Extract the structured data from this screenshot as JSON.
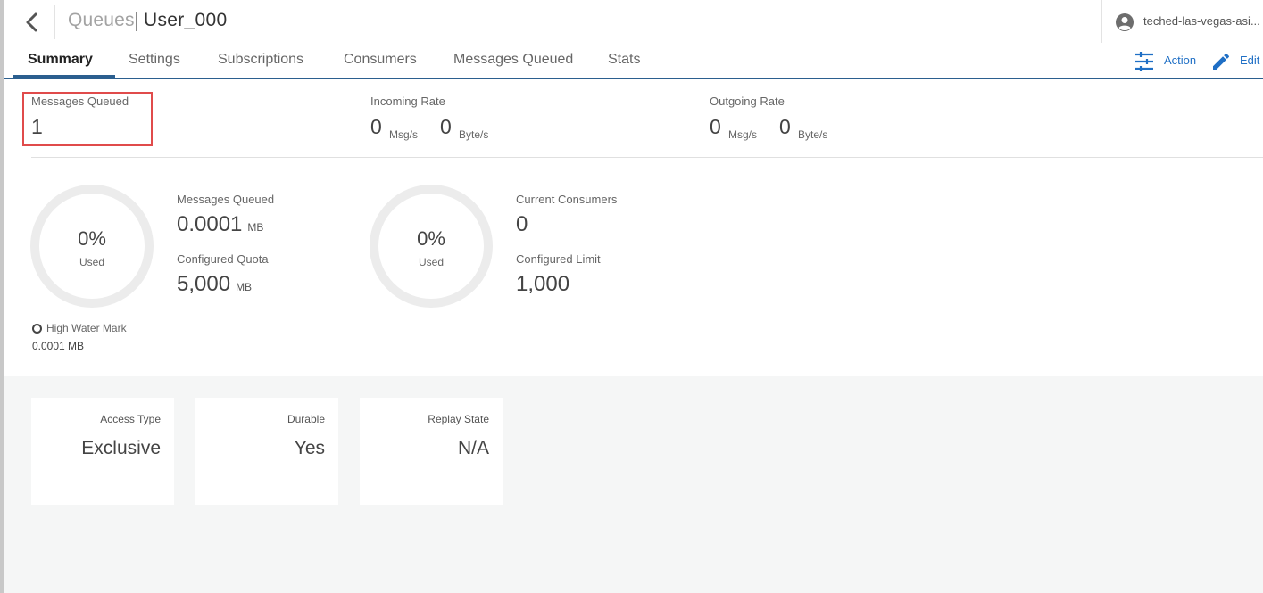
{
  "header": {
    "breadcrumb": "Queues",
    "title": "User_000",
    "user_name": "teched-las-vegas-asi..."
  },
  "tabs": [
    {
      "label": "Summary",
      "active": true
    },
    {
      "label": "Settings",
      "active": false
    },
    {
      "label": "Subscriptions",
      "active": false
    },
    {
      "label": "Consumers",
      "active": false
    },
    {
      "label": "Messages Queued",
      "active": false
    },
    {
      "label": "Stats",
      "active": false
    }
  ],
  "toolbar": {
    "action_label": "Action",
    "edit_label": "Edit",
    "icon_action": "sliders-icon",
    "icon_edit": "pencil-icon",
    "accent_color": "#1f6fc5"
  },
  "stats": {
    "messages_queued": {
      "label": "Messages Queued",
      "value": "1"
    },
    "incoming_rate": {
      "label": "Incoming Rate",
      "msg_value": "0",
      "msg_unit": "Msg/s",
      "byte_value": "0",
      "byte_unit": "Byte/s"
    },
    "outgoing_rate": {
      "label": "Outgoing Rate",
      "msg_value": "0",
      "msg_unit": "Msg/s",
      "byte_value": "0",
      "byte_unit": "Byte/s"
    }
  },
  "storage_gauge": {
    "percent": "0%",
    "used_label": "Used",
    "used_fraction": 0,
    "queued_label": "Messages Queued",
    "queued_value": "0.0001",
    "queued_unit": "MB",
    "quota_label": "Configured Quota",
    "quota_value": "5,000",
    "quota_unit": "MB",
    "hwm_label": "High Water Mark",
    "hwm_value": "0.0001 MB"
  },
  "consumer_gauge": {
    "percent": "0%",
    "used_label": "Used",
    "used_fraction": 0,
    "current_label": "Current Consumers",
    "current_value": "0",
    "limit_label": "Configured Limit",
    "limit_value": "1,000"
  },
  "cards": [
    {
      "label": "Access Type",
      "value": "Exclusive"
    },
    {
      "label": "Durable",
      "value": "Yes"
    },
    {
      "label": "Replay State",
      "value": "N/A"
    }
  ]
}
